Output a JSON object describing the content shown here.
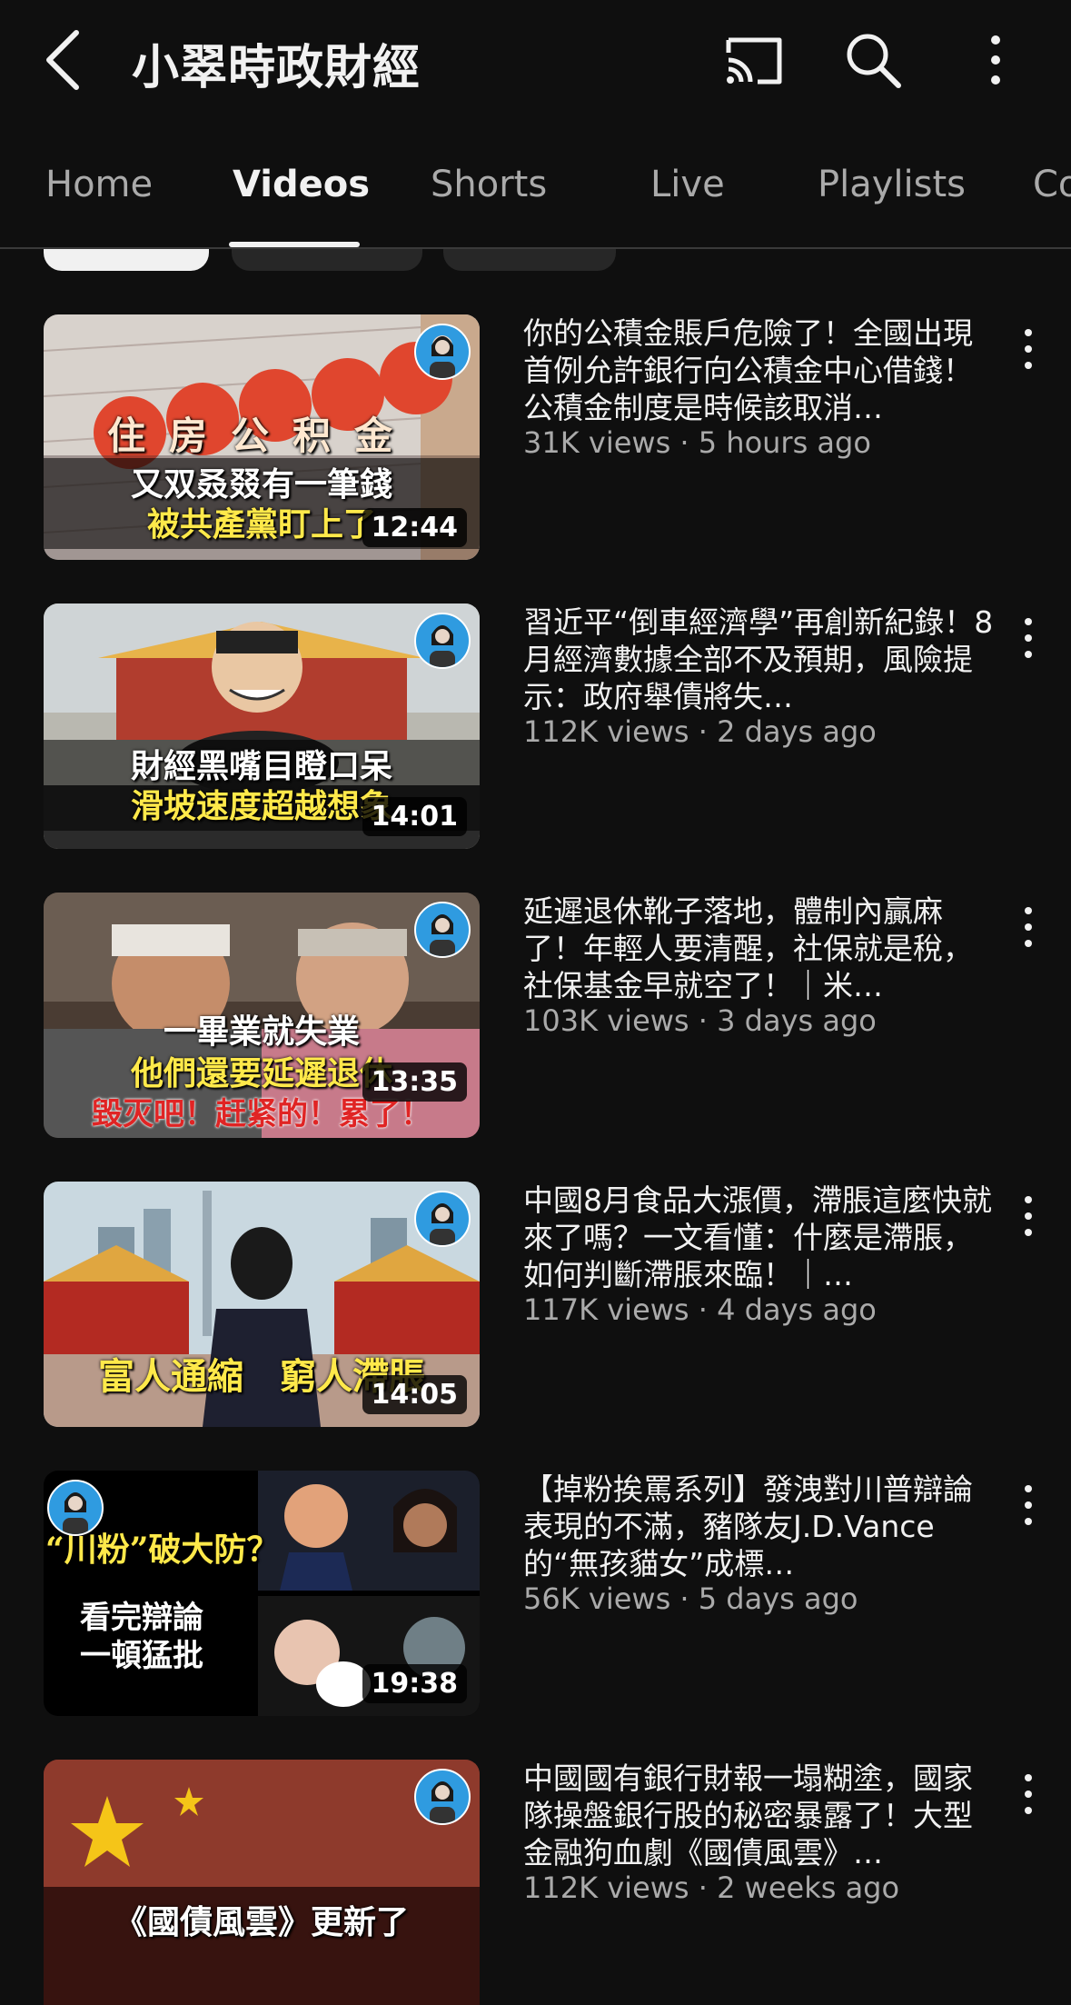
{
  "header": {
    "channel_title": "小翠時政財經",
    "icons": [
      "back-arrow-icon",
      "cast-icon",
      "search-icon",
      "more-vert-icon"
    ]
  },
  "tabs": [
    {
      "label": "Home",
      "active": false
    },
    {
      "label": "Videos",
      "active": true
    },
    {
      "label": "Shorts",
      "active": false
    },
    {
      "label": "Live",
      "active": false
    },
    {
      "label": "Playlists",
      "active": false
    },
    {
      "label": "Co",
      "active": false
    }
  ],
  "videos": [
    {
      "title": "你的公積金賬戶危險了！全國出現首例允許銀行向公積金中心借錢！公積金制度是時候該取消…",
      "meta": "31K views · 5 hours ago",
      "duration": "12:44",
      "thumb_lines": [
        "住房公积金",
        "又双叒叕有一筆錢",
        "被共產黨盯上了"
      ]
    },
    {
      "title": "習近平“倒車經濟學”再創新紀錄！8月經濟數據全部不及預期，風險提示：政府舉債將失…",
      "meta": "112K views · 2 days ago",
      "duration": "14:01",
      "thumb_lines": [
        "財經黑嘴目瞪口呆",
        "滑坡速度超越想象"
      ]
    },
    {
      "title": "延遲退休靴子落地，體制內贏麻了！年輕人要清醒，社保就是稅，社保基金早就空了！｜米…",
      "meta": "103K views · 3 days ago",
      "duration": "13:35",
      "thumb_lines": [
        "一畢業就失業",
        "他們還要延遲退休",
        "毀灭吧！赶紧的！累了！"
      ]
    },
    {
      "title": "中國8月食品大漲價，滯脹這麼快就來了嗎？一文看懂：什麼是滯脹，如何判斷滯脹來臨！｜…",
      "meta": "117K views · 4 days ago",
      "duration": "14:05",
      "thumb_lines": [
        "富人通縮",
        "窮人滯脹"
      ]
    },
    {
      "title": "【掉粉挨罵系列】發洩對川普辯論表現的不滿，豬隊友J.D.Vance的“無孩貓女”成標…",
      "meta": "56K views · 5 days ago",
      "duration": "19:38",
      "thumb_lines": [
        "“川粉”破大防？",
        "看完辯論",
        "一頓猛批"
      ]
    },
    {
      "title": "中國國有銀行財報一塌糊塗，國家隊操盤銀行股的秘密暴露了！大型金融狗血劇《國債風雲》…",
      "meta": "112K views · 2 weeks ago",
      "duration": "",
      "thumb_lines": [
        "《國債風雲》更新了"
      ]
    }
  ]
}
